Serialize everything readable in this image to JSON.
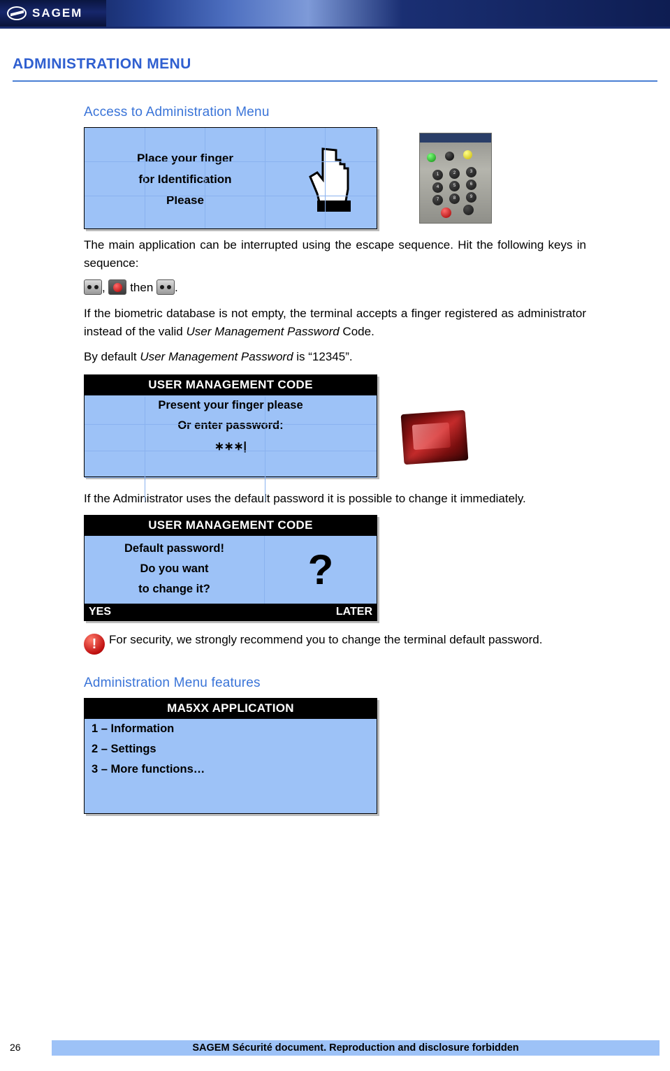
{
  "header": {
    "brand": "SAGEM",
    "logo_icon": "sagem-oval-logo"
  },
  "page_title": "ADMINISTRATION MENU",
  "sections": {
    "access": {
      "heading": "Access to Administration Menu",
      "screen1": {
        "line1": "Place your finger",
        "line2": "for Identification",
        "line3": "Please",
        "icon": "hand-pointer-icon"
      },
      "paragraph1_a": "The main application can be interrupted using the escape sequence. Hit the following keys in sequence:",
      "key_sequence": {
        "key1": "escape-key-icon",
        "comma": ",",
        "key2": "red-key-icon",
        "then": "then",
        "key3": "escape-key-icon",
        "period": "."
      },
      "paragraph2_a": "If the biometric database is not empty, the terminal accepts a finger registered as administrator instead of the valid ",
      "paragraph2_em": "User Management Password",
      "paragraph2_b": " Code.",
      "paragraph3_a": "By default ",
      "paragraph3_em": "User Management Password",
      "paragraph3_b": " is “12345”.",
      "screen2": {
        "title": "USER MANAGEMENT CODE",
        "line1": "Present your finger please",
        "line2": "Or enter password:",
        "line3": "∗∗∗"
      },
      "paragraph4": "If the Administrator uses the default password it is possible to change it immediately.",
      "screen3": {
        "title": "USER MANAGEMENT CODE",
        "line1": "Default password!",
        "line2": "Do you want",
        "line3": "to change it?",
        "glyph": "?",
        "button_left": "YES",
        "button_right": "LATER"
      },
      "warning": {
        "icon": "warning-exclamation-icon",
        "text": "For security, we strongly recommend you to change the terminal default password."
      }
    },
    "features": {
      "heading": "Administration Menu features",
      "screen4": {
        "title": "MA5XX APPLICATION",
        "item1": "1 – Information",
        "item2": "2 – Settings",
        "item3": "3 – More functions…"
      }
    }
  },
  "photos": {
    "keypad_alt": "terminal-keypad-photo",
    "sensor_alt": "red-fingerprint-sensor-photo",
    "keypad_keys": [
      "1",
      "2",
      "3",
      "4",
      "5",
      "6",
      "7",
      "8",
      "9"
    ]
  },
  "footer": {
    "page_number": "26",
    "notice": "SAGEM Sécurité document. Reproduction and disclosure forbidden"
  },
  "colors": {
    "accent_blue": "#3a74d8",
    "lcd_bg": "#9dc2f7",
    "lcd_bar": "#000000",
    "header_band": "#1a2d6e"
  }
}
